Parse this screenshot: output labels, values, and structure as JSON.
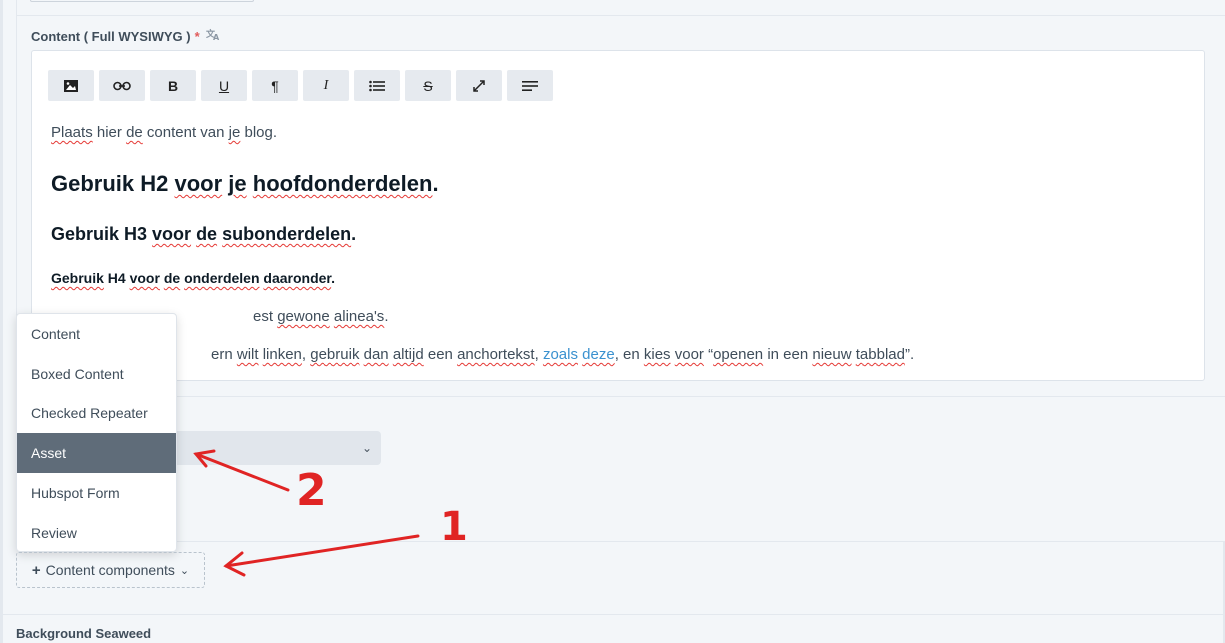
{
  "field": {
    "label": "Content ( Full WYSIWYG )",
    "required_mark": "*",
    "translate_icon": "translate-icon"
  },
  "toolbar": [
    {
      "name": "image-icon",
      "glyph": ""
    },
    {
      "name": "link-icon",
      "glyph": ""
    },
    {
      "name": "bold-button",
      "glyph": "B"
    },
    {
      "name": "underline-button",
      "glyph": "U"
    },
    {
      "name": "paragraph-button",
      "glyph": "¶"
    },
    {
      "name": "italic-button",
      "glyph": "I"
    },
    {
      "name": "list-button",
      "glyph": ""
    },
    {
      "name": "strikethrough-button",
      "glyph": "S"
    },
    {
      "name": "fullscreen-button",
      "glyph": ""
    },
    {
      "name": "align-button",
      "glyph": ""
    }
  ],
  "editor": {
    "p1_a": "Plaats",
    "p1_b": " hier ",
    "p1_c": "de",
    "p1_d": " content van ",
    "p1_e": "je",
    "p1_f": " blog.",
    "h2_a": "Gebruik H2 ",
    "h2_b": "voor",
    "h2_c": " ",
    "h2_d": "je",
    "h2_e": " ",
    "h2_f": "hoofdonderdelen",
    "h2_g": ".",
    "h3_a": "Gebruik H3 ",
    "h3_b": "voor",
    "h3_c": " ",
    "h3_d": "de",
    "h3_e": " ",
    "h3_f": "subonderdelen",
    "h3_g": ".",
    "h4_a": "Gebruik",
    "h4_b": " H4 ",
    "h4_c": "voor",
    "h4_d": " ",
    "h4_e": "de",
    "h4_f": " ",
    "h4_g": "onderdelen",
    "h4_h": " ",
    "h4_i": "daaronder",
    "h4_j": ".",
    "p2_a": "est ",
    "p2_b": "gewone",
    "p2_c": " ",
    "p2_d": "alinea's",
    "p2_e": ".",
    "p3_a": "ern ",
    "p3_b": "wilt",
    "p3_c": " ",
    "p3_d": "linken",
    "p3_e": ", ",
    "p3_f": "gebruik",
    "p3_g": " ",
    "p3_h": "dan",
    "p3_i": " ",
    "p3_j": "altijd",
    "p3_k": " een ",
    "p3_l": "anchortekst",
    "p3_m": ", ",
    "p3_link_a": "zoals",
    "p3_link_b": " ",
    "p3_link_c": "deze",
    "p3_n": ", en ",
    "p3_o": "kies",
    "p3_p": " ",
    "p3_q": "voor",
    "p3_r": " “",
    "p3_s": "openen",
    "p3_t": " in een ",
    "p3_u": "nieuw",
    "p3_v": " ",
    "p3_w": "tabblad",
    "p3_x": "”."
  },
  "dropdown": {
    "items": [
      "Content",
      "Boxed Content",
      "Checked Repeater",
      "Asset",
      "Hubspot Form",
      "Review"
    ],
    "active_index": 3
  },
  "content_components_button": {
    "plus": "+",
    "label": "Content components",
    "chevron": "⌄"
  },
  "select_chevron": "⌄",
  "background_label": "Background Seaweed",
  "annotations": {
    "number_1": "1",
    "number_2": "2",
    "color": "#e02424"
  }
}
